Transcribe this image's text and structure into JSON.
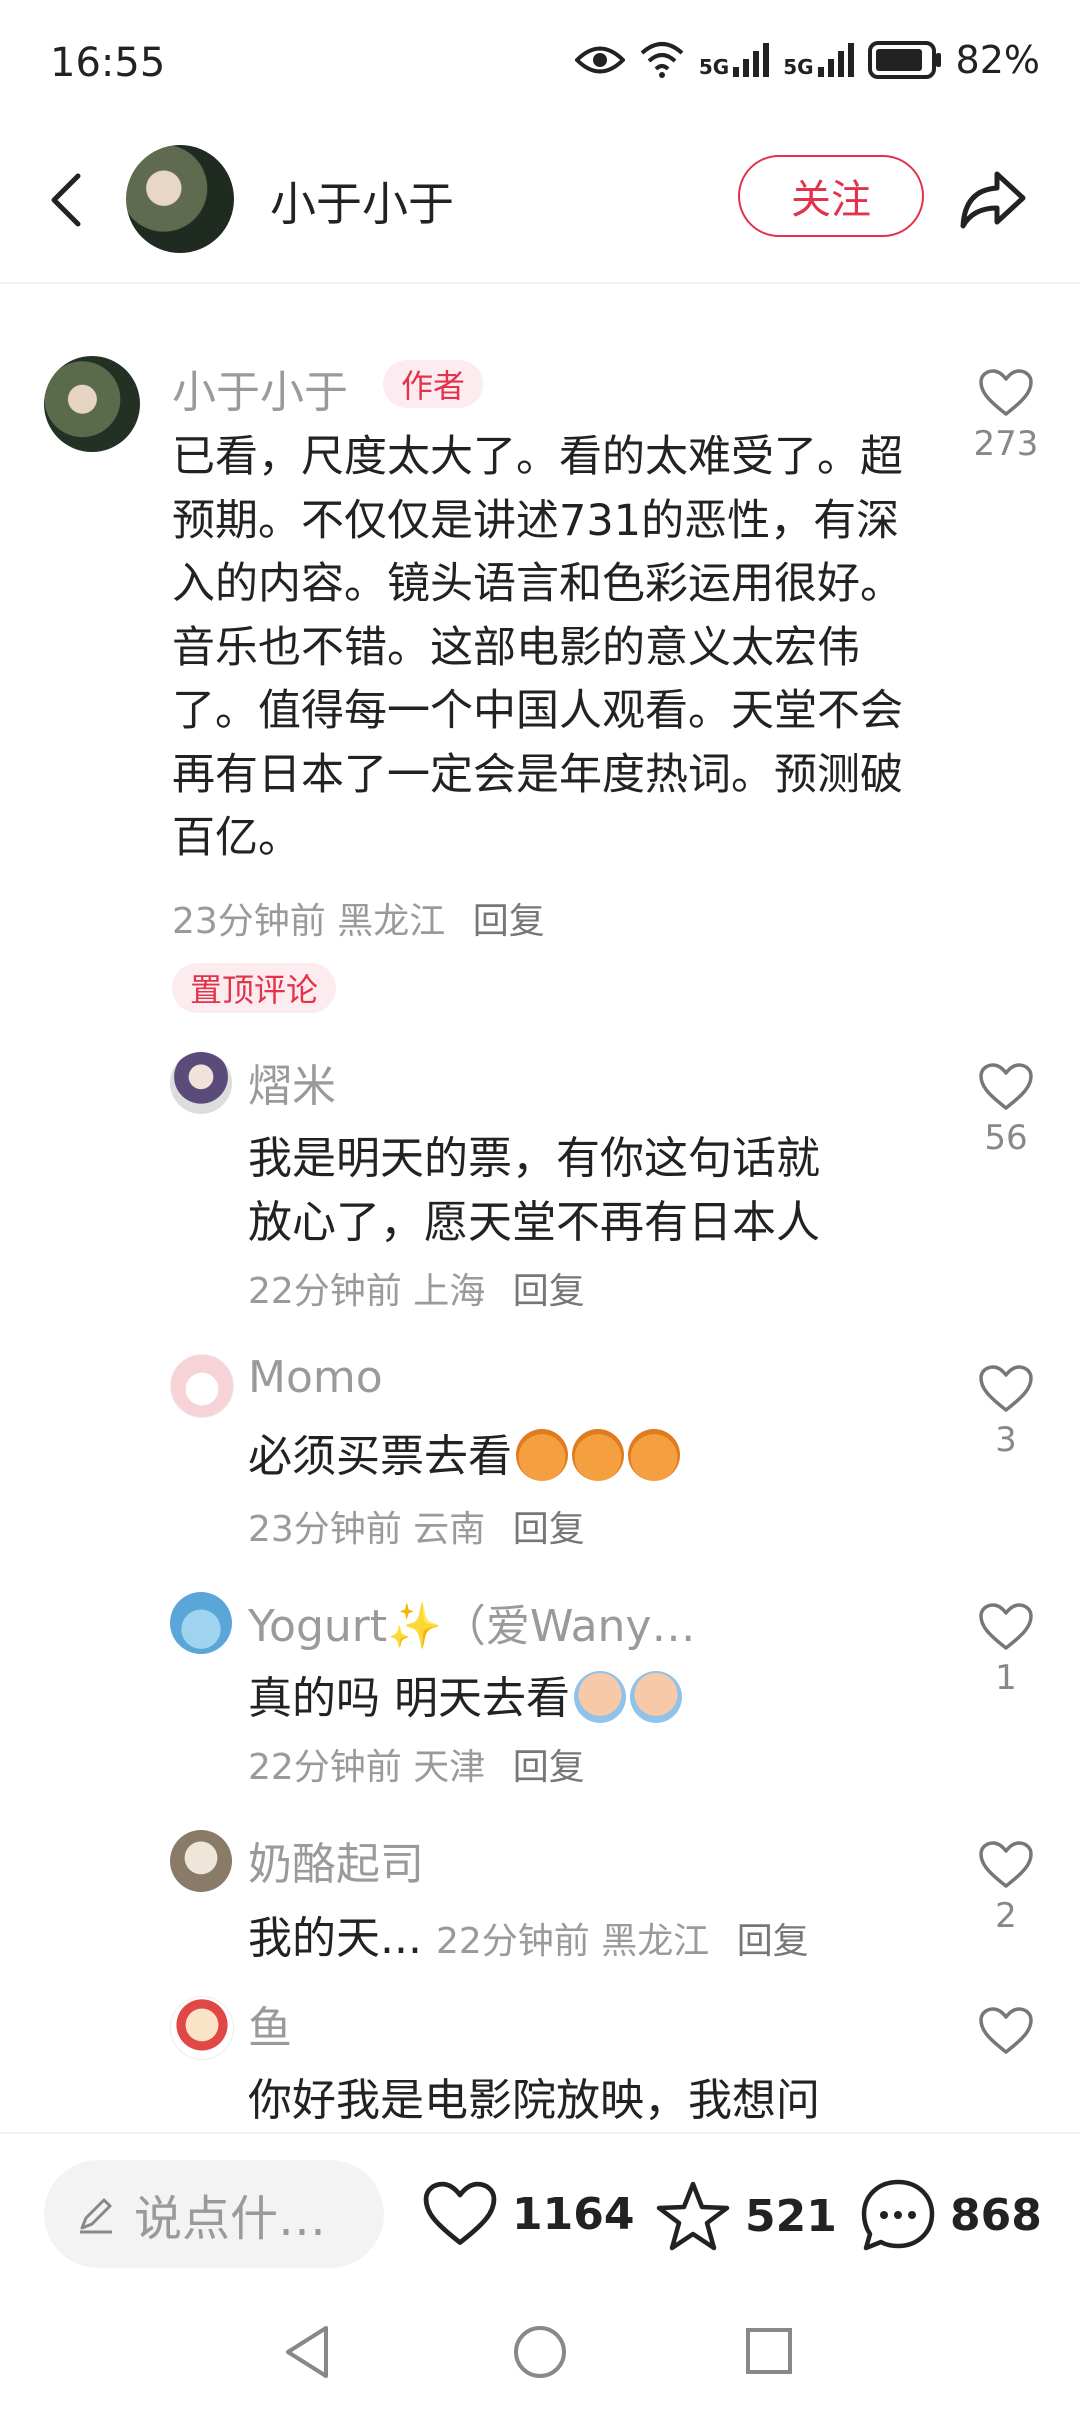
{
  "status_bar": {
    "time": "16:55",
    "battery": "82%",
    "signal1": "5G",
    "signal2": "5G"
  },
  "header": {
    "user_name": "小于小于",
    "follow_label": "关注"
  },
  "main_comment": {
    "author": "小于小于",
    "author_badge": "作者",
    "text": "已看，尺度太大了。看的太难受了。超预期。不仅仅是讲述731的恶性，有深入的内容。镜头语言和色彩运用很好。音乐也不错。这部电影的意义太宏伟了。值得每一个中国人观看。天堂不会再有日本了一定会是年度热词。预测破百亿。",
    "time": "23分钟前",
    "location": "黑龙江",
    "reply_label": "回复",
    "likes": "273",
    "pinned_label": "置顶评论"
  },
  "replies": [
    {
      "name": "熠米",
      "text1": "我是明天的票，有你这句话就",
      "text2": "放心了，愿天堂不再有日本人",
      "time": "22分钟前",
      "location": "上海",
      "reply_label": "回复",
      "likes": "56"
    },
    {
      "name": "Momo",
      "text": "必须买票去看",
      "time": "23分钟前",
      "location": "云南",
      "reply_label": "回复",
      "likes": "3"
    },
    {
      "name": "Yogurt✨（爱Wany…",
      "text": "真的吗 明天去看",
      "time": "22分钟前",
      "location": "天津",
      "reply_label": "回复",
      "likes": "1"
    },
    {
      "name": "奶酪起司",
      "text": "我的天...",
      "time": "22分钟前",
      "location": "黑龙江",
      "reply_label": "回复",
      "likes": "2"
    },
    {
      "name": "鱼",
      "text": "你好我是电影院放映，我想问",
      "likes": ""
    }
  ],
  "bottom_bar": {
    "input_placeholder": "说点什…",
    "likes": "1164",
    "stars": "521",
    "comments": "868"
  }
}
